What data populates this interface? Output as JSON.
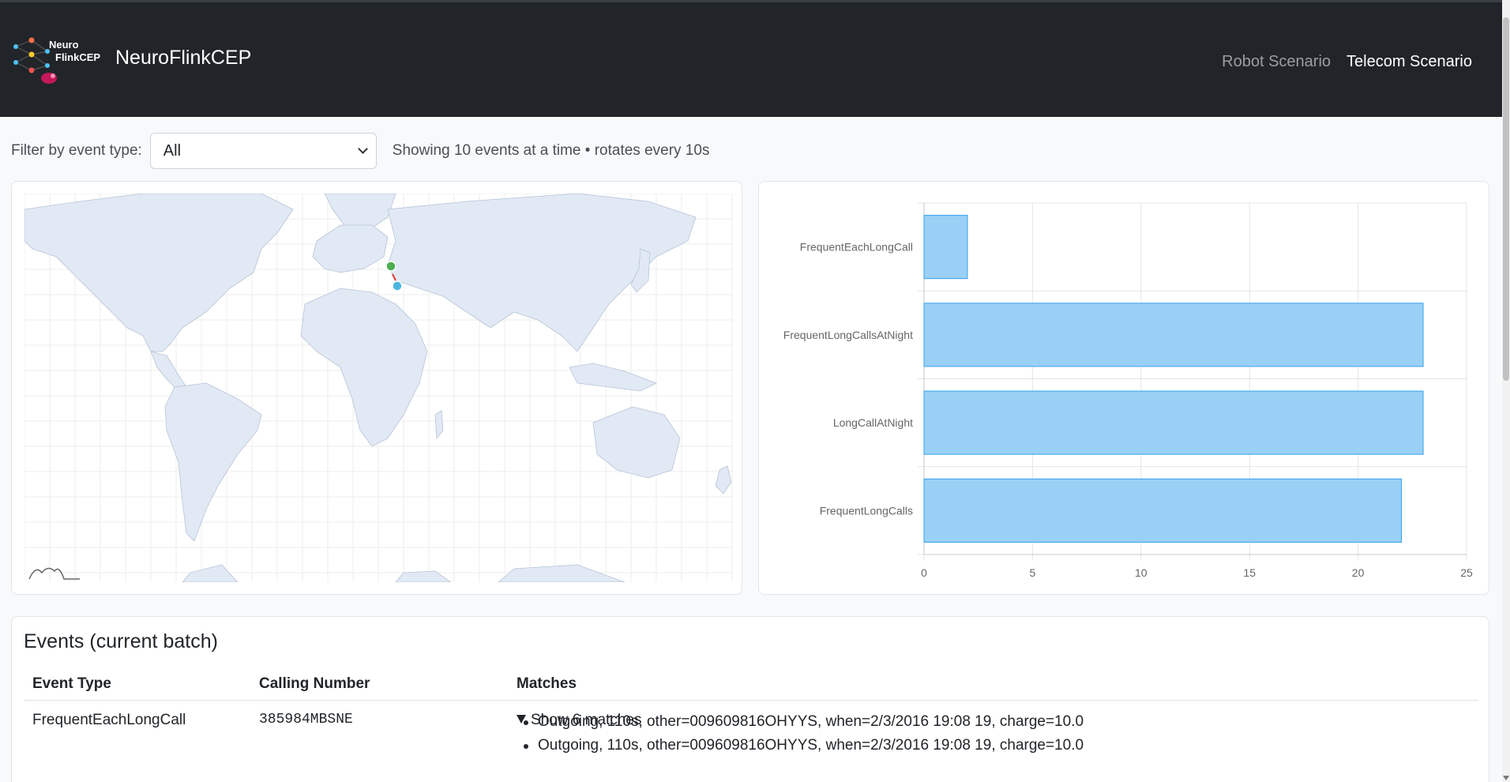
{
  "navbar": {
    "logo_text_1": "Neuro",
    "logo_text_2": "FlinkCEP",
    "brand_name": "NeuroFlinkCEP",
    "links": [
      {
        "label": "Robot Scenario",
        "active": false
      },
      {
        "label": "Telecom Scenario",
        "active": true
      }
    ]
  },
  "filter": {
    "label": "Filter by event type:",
    "selected": "All",
    "info": "Showing 10 events at a time • rotates every 10s"
  },
  "map": {
    "markers": [
      {
        "name": "green-marker",
        "color": "#4caf50"
      },
      {
        "name": "blue-marker",
        "color": "#4db6dd"
      }
    ]
  },
  "chart_data": {
    "type": "bar",
    "orientation": "horizontal",
    "categories": [
      "FrequentEachLongCall",
      "FrequentLongCallsAtNight",
      "LongCallAtNight",
      "FrequentLongCalls"
    ],
    "values": [
      2,
      23,
      23,
      22
    ],
    "xlim": [
      0,
      25
    ],
    "xticks": [
      0,
      5,
      10,
      15,
      20,
      25
    ],
    "grid": true,
    "bar_color": "#9ad0f5",
    "bar_border": "#36a2eb"
  },
  "events": {
    "title": "Events (current batch)",
    "columns": [
      "Event Type",
      "Calling Number",
      "Matches"
    ],
    "rows": [
      {
        "event_type": "FrequentEachLongCall",
        "calling_number": "385984MBSNE",
        "matches_summary": "Show 6 matches",
        "matches": [
          "Outgoing, 110s, other=009609816OHYYS, when=2/3/2016 19:08 19, charge=10.0",
          "Outgoing, 110s, other=009609816OHYYS, when=2/3/2016 19:08 19, charge=10.0"
        ]
      }
    ]
  }
}
